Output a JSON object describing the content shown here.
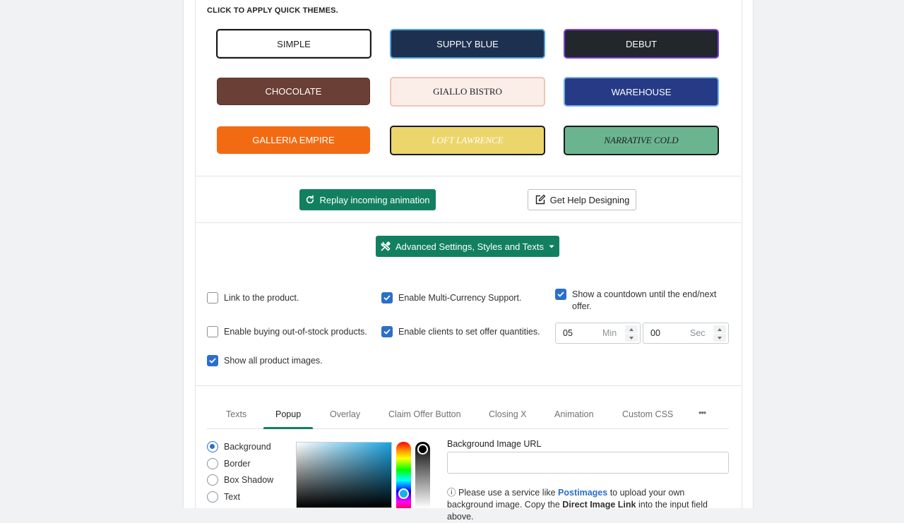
{
  "quick_themes": {
    "title": "CLICK TO APPLY QUICK THEMES.",
    "themes": [
      {
        "label": "SIMPLE",
        "bg": "#ffffff",
        "fg": "#202223",
        "border": "#1a1a1a"
      },
      {
        "label": "SUPPLY BLUE",
        "bg": "#1d3050",
        "fg": "#ffffff",
        "border": "#4a9ee0"
      },
      {
        "label": "DEBUT",
        "bg": "#22272b",
        "fg": "#ffffff",
        "border": "#7e3fe0"
      },
      {
        "label": "CHOCOLATE",
        "bg": "#6a3f35",
        "fg": "#ffffff",
        "border": "#5a342b"
      },
      {
        "label": "GIALLO BISTRO",
        "bg": "#fbeee8",
        "fg": "#202223",
        "border": "#f0c4b8"
      },
      {
        "label": "WAREHOUSE",
        "bg": "#263a86",
        "fg": "#ffffff",
        "border": "#6fb0e6"
      },
      {
        "label": "GALLERIA EMPIRE",
        "bg": "#f26b12",
        "fg": "#ffffff",
        "border": "#f26b12"
      },
      {
        "label": "LOFT LAWRENCE",
        "bg": "#ecd56a",
        "fg": "#ffffff",
        "border": "#1a1a1a"
      },
      {
        "label": "NARRATIVE COLD",
        "bg": "#6ab590",
        "fg": "#202223",
        "border": "#1a1a1a"
      }
    ]
  },
  "actions": {
    "replay_label": "Replay incoming animation",
    "help_label": "Get Help Designing",
    "advanced_label": "Advanced Settings, Styles and Texts"
  },
  "options": {
    "link_product": "Link to the product.",
    "out_of_stock": "Enable buying out-of-stock products.",
    "show_images": "Show all product images.",
    "multi_currency": "Enable Multi-Currency Support.",
    "set_quantities": "Enable clients to set offer quantities.",
    "countdown": "Show a countdown until the end/next offer.",
    "link_product_checked": false,
    "out_of_stock_checked": false,
    "show_images_checked": true,
    "multi_currency_checked": true,
    "set_quantities_checked": true,
    "countdown_checked": true
  },
  "countdown": {
    "minutes_value": "05",
    "minutes_unit": "Min",
    "seconds_value": "00",
    "seconds_unit": "Sec"
  },
  "tabs": {
    "items": [
      "Texts",
      "Popup",
      "Overlay",
      "Claim Offer Button",
      "Closing X",
      "Animation",
      "Custom CSS"
    ],
    "active": "Popup",
    "more": "•••"
  },
  "popup_settings": {
    "targets": [
      "Background",
      "Border",
      "Box Shadow",
      "Text"
    ],
    "selected_target": "Background",
    "bg_image_label": "Background Image URL",
    "bg_image_value": "",
    "help_prefix": "Please use a service like ",
    "help_link": "Postimages",
    "help_middle": " to upload your own background image. Copy the ",
    "help_bold": "Direct Image Link",
    "help_suffix": " into the input field above."
  },
  "colors": {
    "accent_green": "#128060",
    "checkbox_blue": "#2c6ecb",
    "link_blue": "#2c6ecb"
  }
}
